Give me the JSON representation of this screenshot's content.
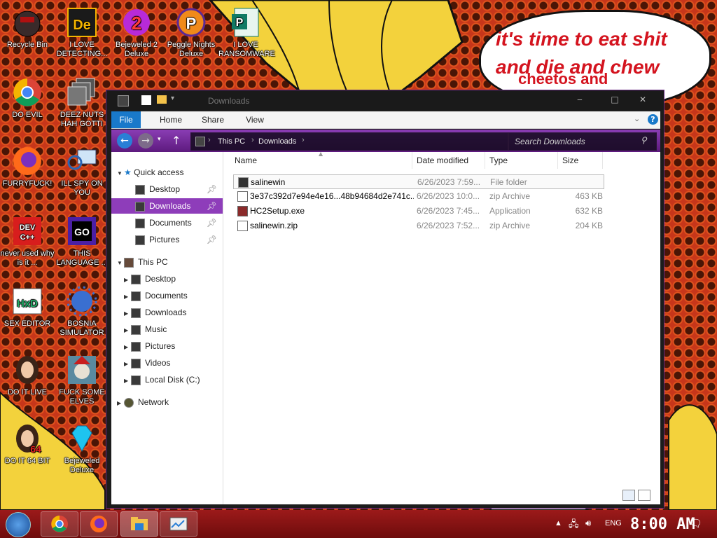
{
  "desktop": {
    "bubble_text_line1": "it's time to eat shit",
    "bubble_text_line2": "and die and chew",
    "bubble_text_line3": "cheetos and",
    "icons": [
      {
        "label": "Recycle Bin"
      },
      {
        "label": "I LOVE DETECTING..."
      },
      {
        "label": "Bejeweled 2 Deluxe"
      },
      {
        "label": "Peggle Nights Deluxe"
      },
      {
        "label": "I LOVE RANSOMWARE"
      },
      {
        "label": "DO EVIL"
      },
      {
        "label": "DEEZ NUTS HAH GOTTI"
      },
      {
        "label": "FURRYFUCK!"
      },
      {
        "label": "ILL SPY ON YOU"
      },
      {
        "label": "never used why is it ..."
      },
      {
        "label": "THIS LANGUAGE ..."
      },
      {
        "label": "SEX EDITOR"
      },
      {
        "label": "BOSNIA SIMULATOR"
      },
      {
        "label": "DO IT LIVE"
      },
      {
        "label": "FUCK SOME ELVES"
      },
      {
        "label": "DO IT 64 BIT"
      },
      {
        "label": "Bejeweled Deluxe"
      }
    ],
    "icon_glyphs": {
      "de": "De",
      "bej2": "2",
      "peggle": "P",
      "pub": "P",
      "go": "GO",
      "dev": "DEV C++",
      "hxd": "HxD",
      "sixtyfour": "64"
    }
  },
  "window": {
    "title": "Downloads",
    "ribbon_tabs": [
      "File",
      "Home",
      "Share",
      "View"
    ],
    "breadcrumb": [
      "This PC",
      "Downloads"
    ],
    "search_placeholder": "Search Downloads",
    "nav": {
      "quick_access": "Quick access",
      "quick_items": [
        "Desktop",
        "Downloads",
        "Documents",
        "Pictures"
      ],
      "this_pc": "This PC",
      "pc_items": [
        "Desktop",
        "Documents",
        "Downloads",
        "Music",
        "Pictures",
        "Videos",
        "Local Disk (C:)"
      ],
      "network": "Network"
    },
    "columns": [
      "Name",
      "Date modified",
      "Type",
      "Size"
    ],
    "files": [
      {
        "name": "salinewin",
        "date": "6/26/2023 7:59...",
        "type": "File folder",
        "size": ""
      },
      {
        "name": "3e37c392d7e94e4e16...48b94684d2e741c...",
        "date": "6/26/2023 10:0...",
        "type": "zip Archive",
        "size": "463 KB"
      },
      {
        "name": "HC2Setup.exe",
        "date": "6/26/2023 7:45...",
        "type": "Application",
        "size": "632 KB"
      },
      {
        "name": "salinewin.zip",
        "date": "6/26/2023 7:52...",
        "type": "zip Archive",
        "size": "204 KB"
      }
    ]
  },
  "taskbar": {
    "language": "ENG",
    "clock": "8:00 AM"
  },
  "colors": {
    "accent": "#8e3dba",
    "taskbar": "#9c1a1a",
    "bubble_text": "#d4141f"
  }
}
